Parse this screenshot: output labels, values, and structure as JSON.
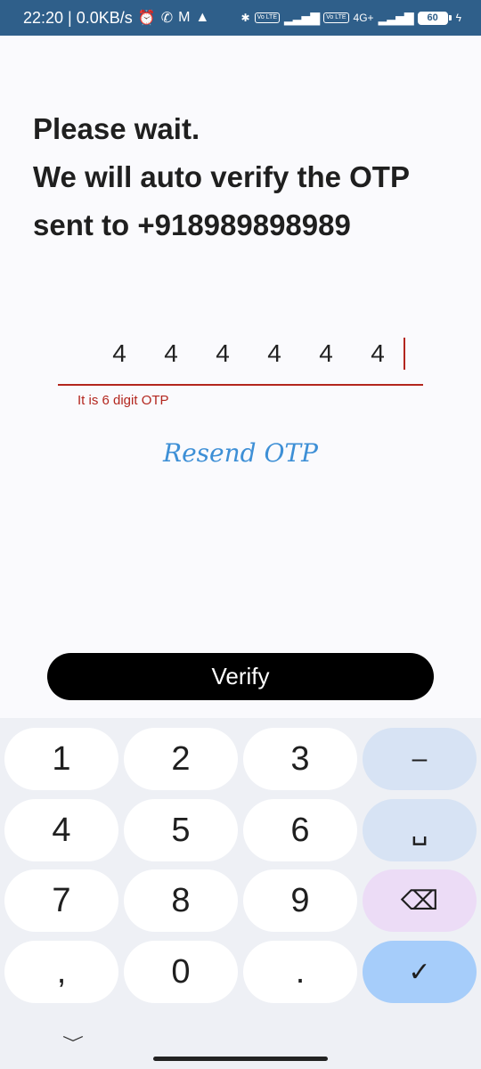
{
  "status_bar": {
    "time_speed": "22:20 | 0.0KB/s",
    "icons": [
      "alarm-icon",
      "whatsapp-icon",
      "gmail-icon",
      "app-icon"
    ],
    "sim1_badge": "Vo LTE",
    "sim2_badge": "Vo LTE",
    "network_type": "4G+",
    "battery": "60"
  },
  "heading": {
    "line1": "Please wait.",
    "line2": "We will auto verify the OTP",
    "line3": "sent to +918989898989"
  },
  "otp": {
    "digits": [
      "4",
      "4",
      "4",
      "4",
      "4",
      "4"
    ],
    "error": "It is 6 digit OTP"
  },
  "resend_label": "Resend OTP",
  "verify_label": "Verify",
  "keyboard": {
    "keys": [
      "1",
      "2",
      "3",
      "–",
      "4",
      "5",
      "6",
      "␣",
      "7",
      "8",
      "9",
      "⌫",
      ",",
      "0",
      ".",
      "✓"
    ]
  },
  "colors": {
    "status_bar": "#2f5f8a",
    "error": "#b3261e",
    "link": "#3d8fd6",
    "button": "#000000",
    "key_func": "#d7e3f4",
    "key_enter": "#a6cdfa",
    "key_backspace": "#ecdcf6"
  }
}
